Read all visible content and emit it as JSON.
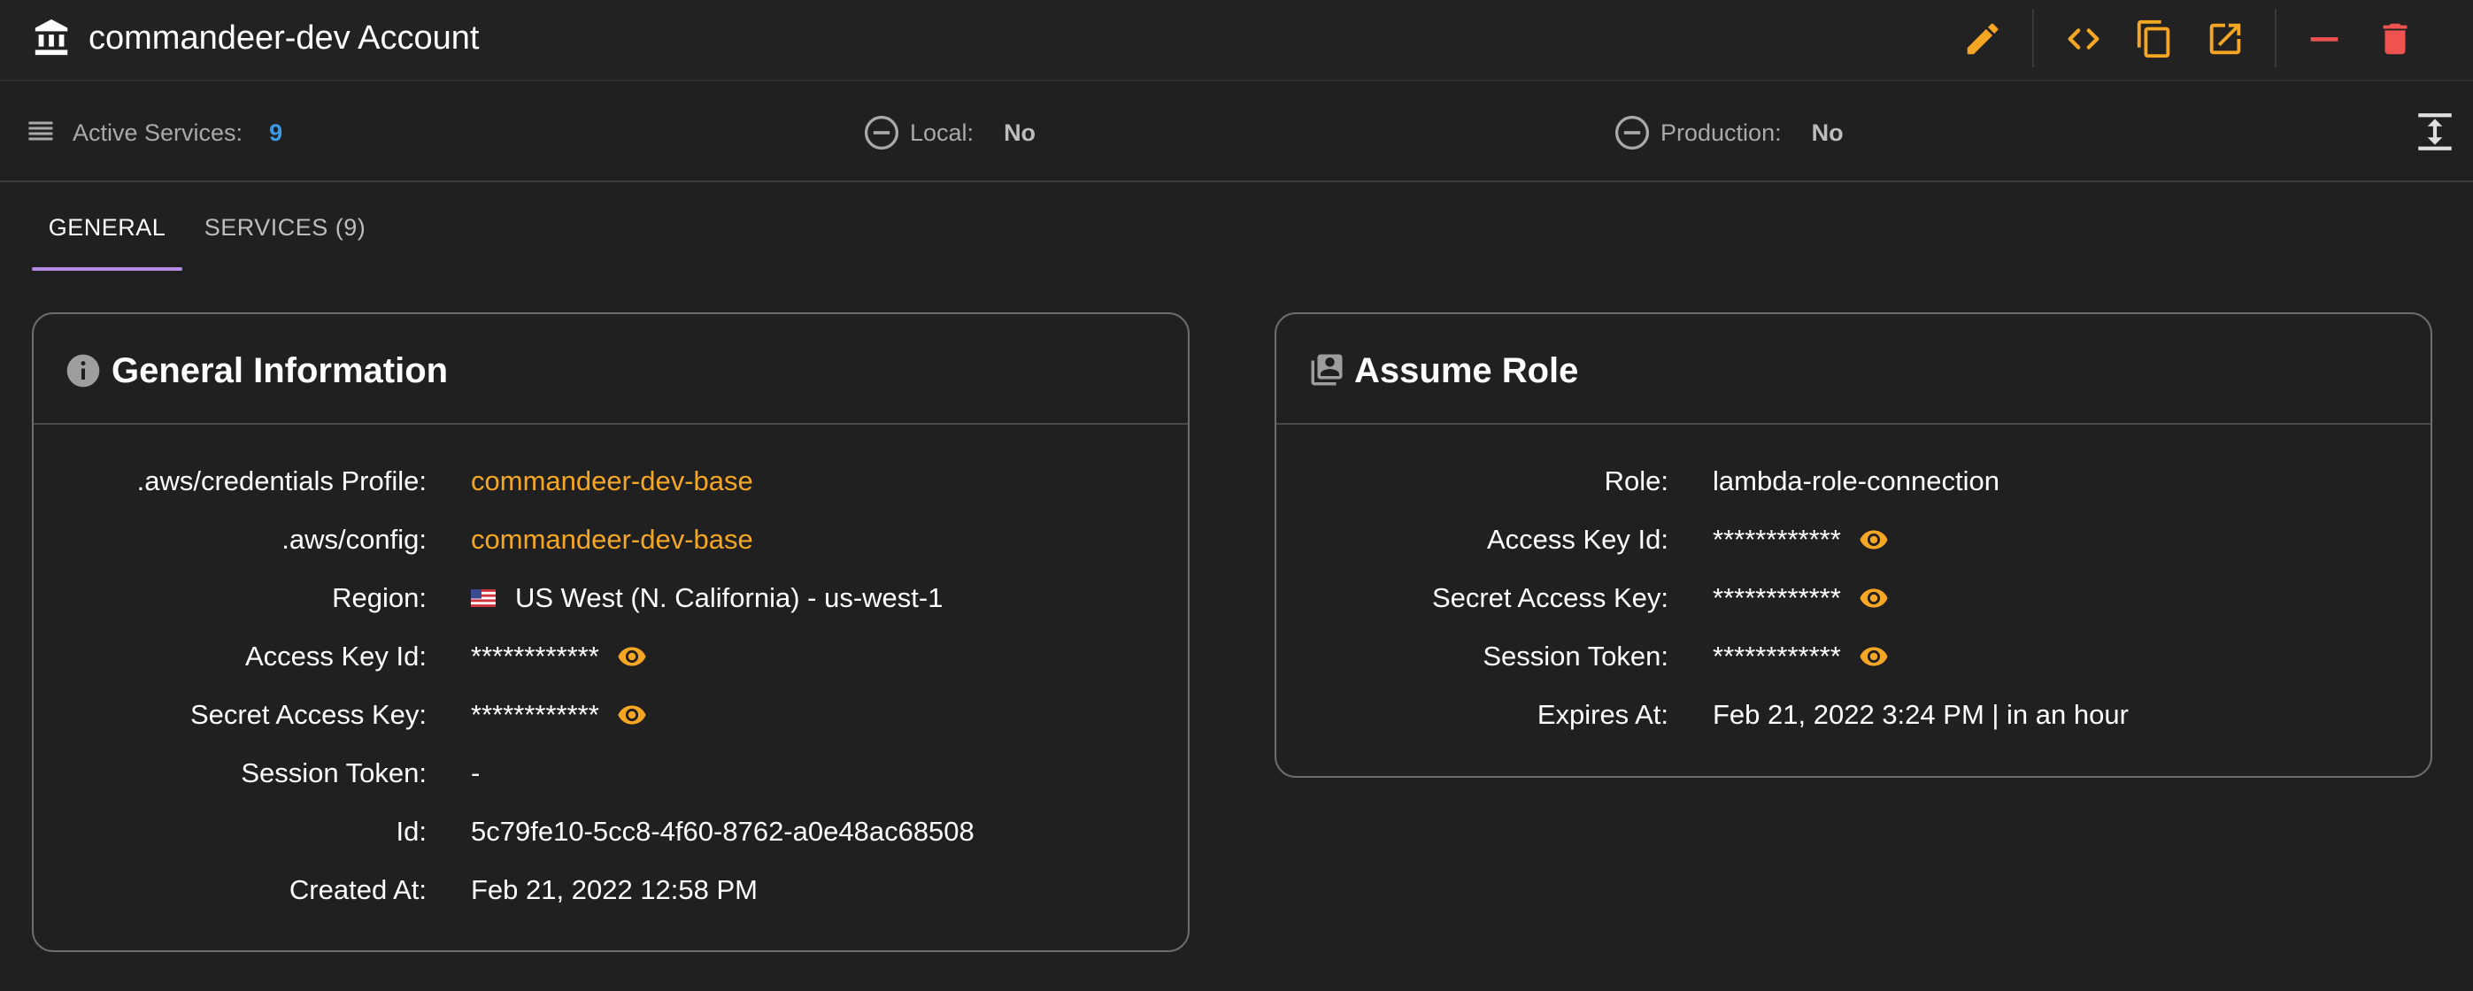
{
  "header": {
    "title": "commandeer-dev Account"
  },
  "stats": {
    "active_services_label": "Active Services:",
    "active_services_value": "9",
    "local_label": "Local:",
    "local_value": "No",
    "production_label": "Production:",
    "production_value": "No"
  },
  "tabs": [
    {
      "label": "GENERAL",
      "active": true
    },
    {
      "label": "SERVICES (9)",
      "active": false
    }
  ],
  "general": {
    "title": "General Information",
    "rows": [
      {
        "key": ".aws/credentials Profile:",
        "value": "commandeer-dev-base"
      },
      {
        "key": ".aws/config:",
        "value": "commandeer-dev-base"
      },
      {
        "key": "Region:",
        "value": "US West (N. California) - us-west-1"
      },
      {
        "key": "Access Key Id:",
        "value": "************"
      },
      {
        "key": "Secret Access Key:",
        "value": "************"
      },
      {
        "key": "Session Token:",
        "value": "-"
      },
      {
        "key": "Id:",
        "value": "5c79fe10-5cc8-4f60-8762-a0e48ac68508"
      },
      {
        "key": "Created At:",
        "value": "Feb 21, 2022 12:58 PM"
      }
    ]
  },
  "assume_role": {
    "title": "Assume Role",
    "rows": [
      {
        "key": "Role:",
        "value": "lambda-role-connection"
      },
      {
        "key": "Access Key Id:",
        "value": "************"
      },
      {
        "key": "Secret Access Key:",
        "value": "************"
      },
      {
        "key": "Session Token:",
        "value": "************"
      },
      {
        "key": "Expires At:",
        "value": "Feb 21, 2022 3:24 PM | in an hour"
      }
    ]
  },
  "colors": {
    "accent": "#f5a623",
    "danger": "#ef5350",
    "link_blue": "#3a9be8",
    "tab_indicator": "#b58be6",
    "background": "#202020"
  },
  "icons": {
    "header": [
      "bank-icon",
      "edit-icon",
      "code-icon",
      "copy-icon",
      "open-external-icon",
      "minimize-icon",
      "delete-icon"
    ],
    "stats": [
      "list-icon",
      "minus-circle-icon",
      "minus-circle-icon",
      "expand-vertical-icon"
    ],
    "cards": [
      "info-icon",
      "assume-role-icon",
      "eye-icon",
      "us-flag-icon"
    ]
  }
}
